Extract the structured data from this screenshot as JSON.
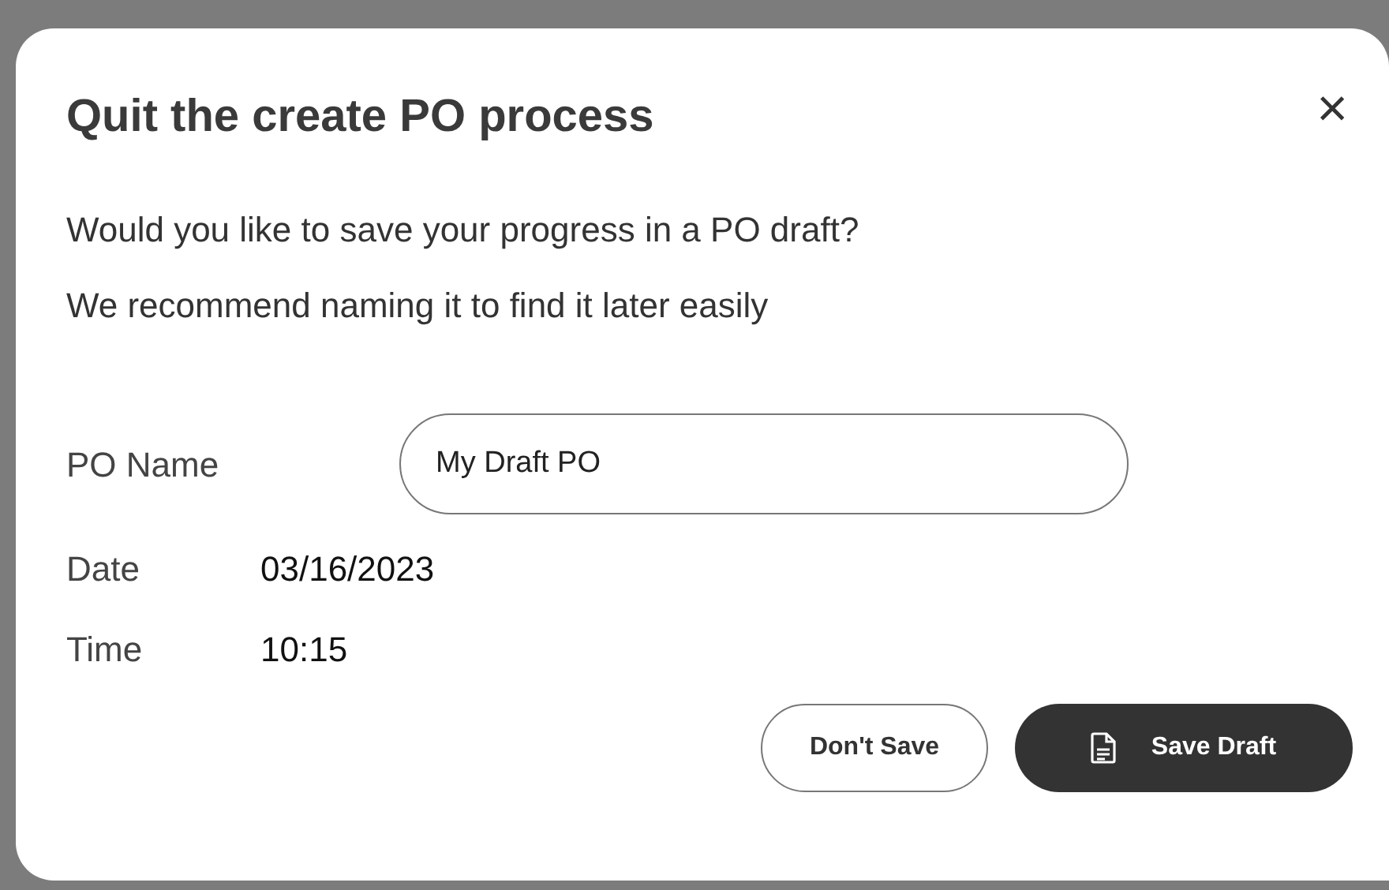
{
  "dialog": {
    "title": "Quit the create PO process",
    "close": "×",
    "message_lines": [
      "Would you like to save your progress in a PO draft?",
      "We recommend naming it to find it later easily"
    ],
    "fields": [
      {
        "label": "PO Name",
        "kind": "input",
        "value": "My Draft PO"
      },
      {
        "label": "Date",
        "kind": "text",
        "value": "03/16/2023"
      },
      {
        "label": "Time",
        "kind": "text",
        "value": "10:15"
      }
    ],
    "buttons": [
      {
        "label": "Don't Save",
        "kind": "secondary"
      },
      {
        "label": "Save Draft",
        "kind": "primary"
      }
    ]
  }
}
